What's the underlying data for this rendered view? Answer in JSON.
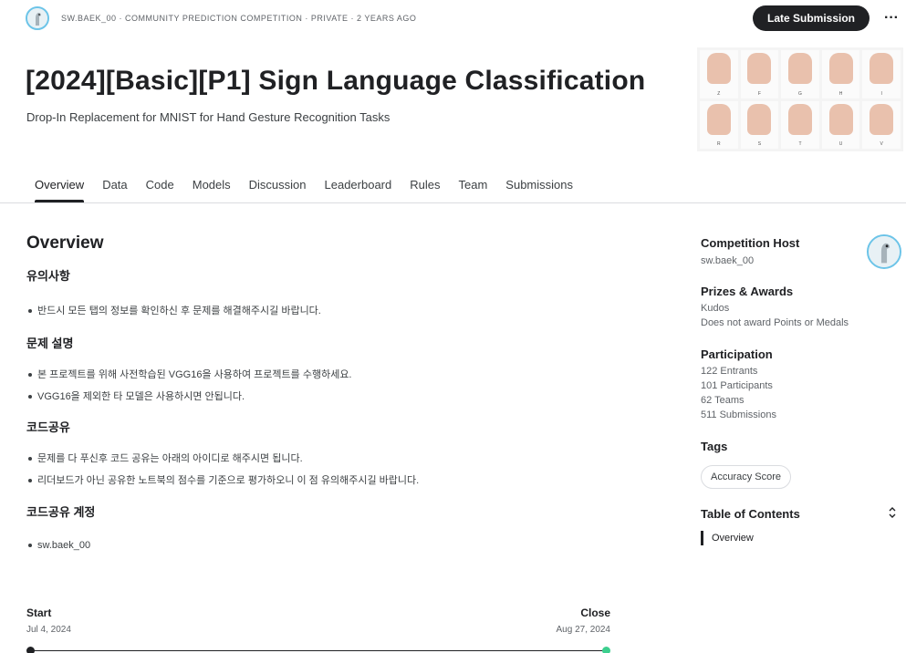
{
  "header": {
    "meta": "SW.BAEK_00 · COMMUNITY PREDICTION COMPETITION · PRIVATE · 2 YEARS AGO",
    "late_submission_label": "Late Submission",
    "more_label": "···"
  },
  "competition": {
    "title": "[2024][Basic][P1] Sign Language Classification",
    "subtitle": "Drop-In Replacement for MNIST for Hand Gesture Recognition Tasks",
    "banner_letters": [
      "Z",
      "F",
      "G",
      "H",
      "I",
      "R",
      "S",
      "T",
      "U",
      "V"
    ]
  },
  "tabs": [
    {
      "label": "Overview",
      "active": true
    },
    {
      "label": "Data"
    },
    {
      "label": "Code"
    },
    {
      "label": "Models"
    },
    {
      "label": "Discussion"
    },
    {
      "label": "Leaderboard"
    },
    {
      "label": "Rules"
    },
    {
      "label": "Team"
    },
    {
      "label": "Submissions"
    }
  ],
  "overview": {
    "heading": "Overview",
    "sections": [
      {
        "heading": "유의사항",
        "bullets": [
          "반드시 모든 탭의 정보를 확인하신 후 문제를 해결해주시길 바랍니다."
        ]
      },
      {
        "heading": "문제 설명",
        "bullets": [
          "본 프로젝트를 위해 사전학습된 VGG16을 사용하여 프로젝트를 수행하세요.",
          "VGG16을 제외한 타 모델은 사용하시면 안됩니다."
        ]
      },
      {
        "heading": "코드공유",
        "bullets": [
          "문제를 다 푸신후 코드 공유는 아래의 아이디로 해주시면 됩니다.",
          "리더보드가 아닌 공유한 노트북의 점수를 기준으로 평가하오니 이 점 유의해주시길 바랍니다."
        ]
      },
      {
        "heading": "코드공유 계정",
        "bullets": [
          "sw.baek_00"
        ]
      }
    ]
  },
  "timeline": {
    "start_label": "Start",
    "start_date": "Jul 4, 2024",
    "close_label": "Close",
    "close_date": "Aug 27, 2024"
  },
  "sidebar": {
    "host_heading": "Competition Host",
    "host_name": "sw.baek_00",
    "prizes_heading": "Prizes & Awards",
    "prizes_line1": "Kudos",
    "prizes_line2": "Does not award Points or Medals",
    "participation_heading": "Participation",
    "entrants": "122 Entrants",
    "participants": "101 Participants",
    "teams": "62 Teams",
    "submissions": "511 Submissions",
    "tags_heading": "Tags",
    "tag": "Accuracy Score",
    "toc_heading": "Table of Contents",
    "toc_toggle": "⌃⌄",
    "toc_item": "Overview"
  },
  "colors": {
    "accent_dark": "#202124",
    "avatar_ring": "#6cc4e8",
    "timeline_end": "#3ccf8e"
  }
}
